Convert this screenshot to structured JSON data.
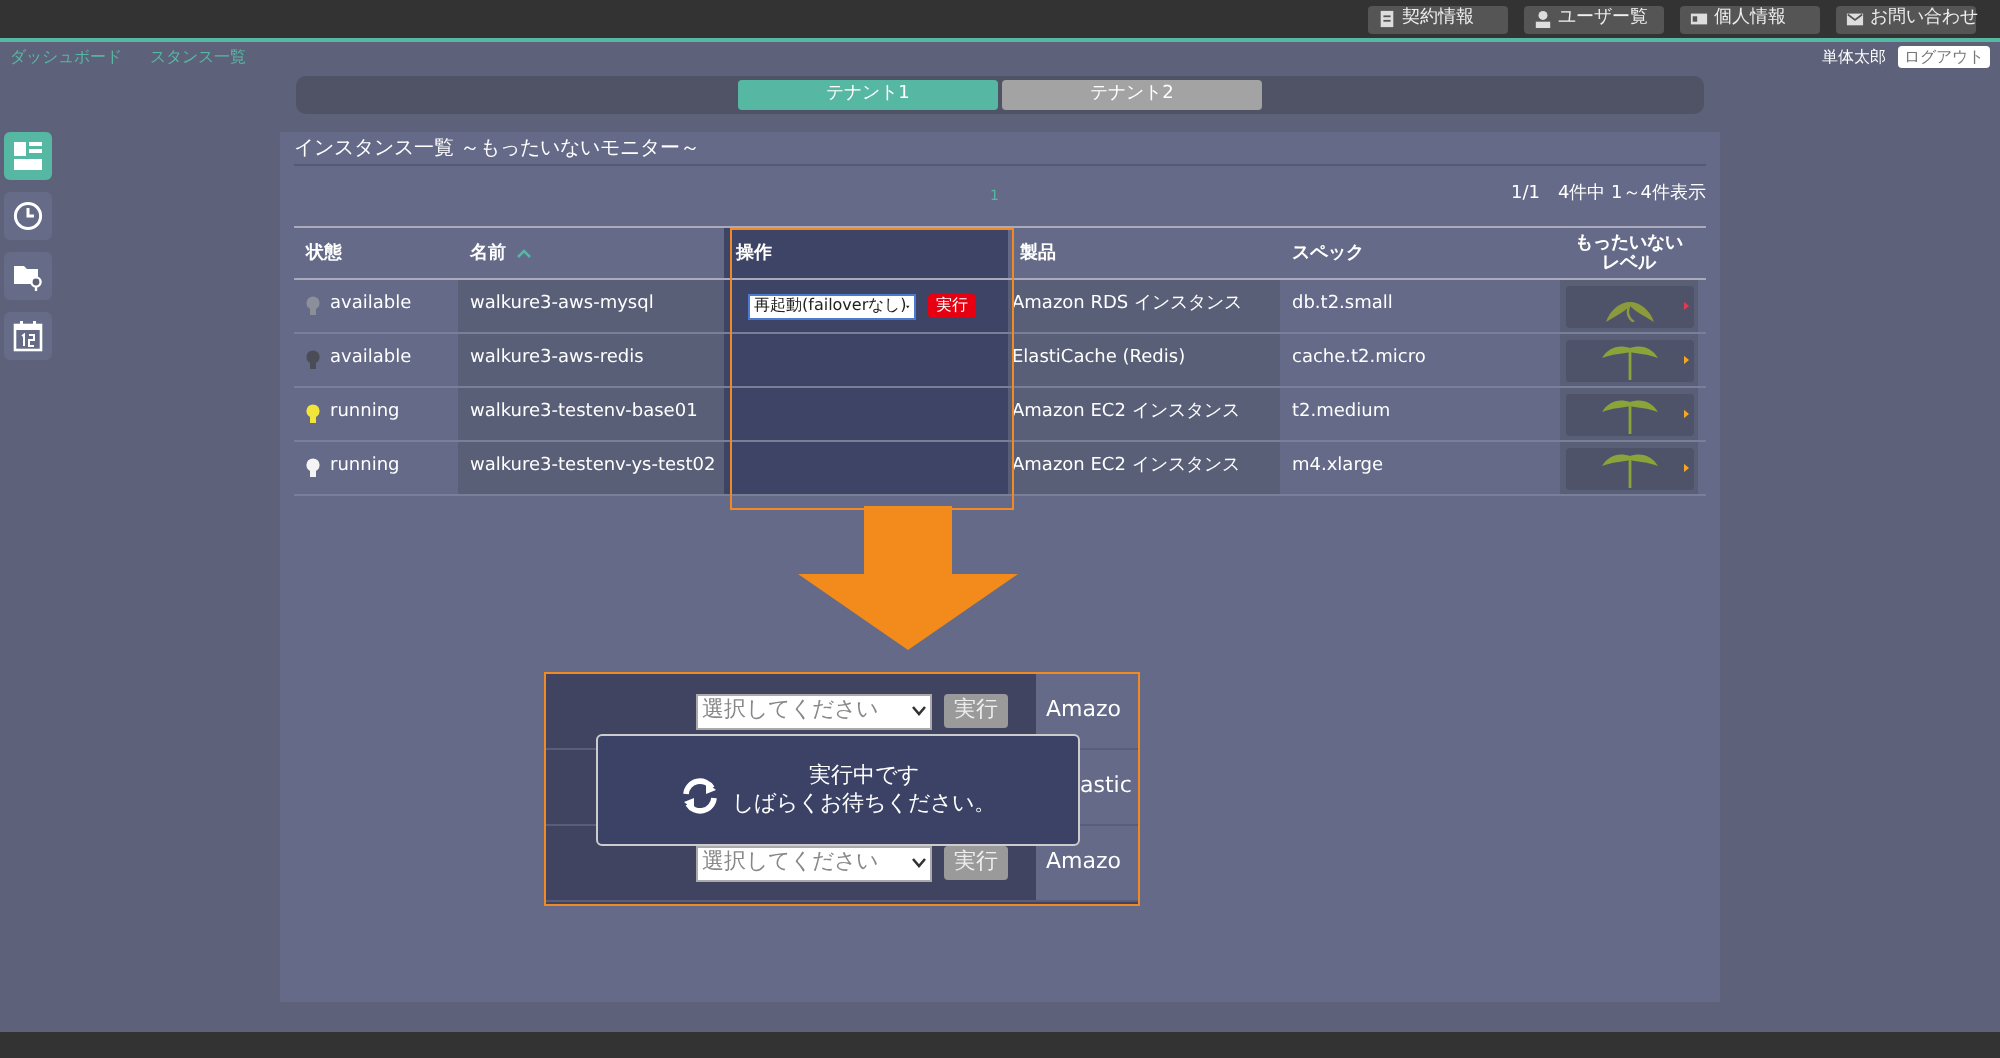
{
  "header": {
    "buttons": [
      {
        "label": "契約情報"
      },
      {
        "label": "ユーザー覧"
      },
      {
        "label": "個人情報"
      },
      {
        "label": "お問い合わせ"
      }
    ]
  },
  "breadcrumbs": [
    "ダッシュボード",
    "スタンス一覧"
  ],
  "user": {
    "name": "単体太郎",
    "logout": "ログアウト"
  },
  "sidebar": {
    "items": [
      {
        "selected": true
      },
      {
        "selected": false
      },
      {
        "selected": false
      },
      {
        "selected": false
      }
    ]
  },
  "tenant_tabs": [
    {
      "label": "テナント1",
      "selected": true
    },
    {
      "label": "テナント2",
      "selected": false
    }
  ],
  "panel": {
    "title": "インスタンス一覧 ～もったいないモニター～",
    "page_link": "1",
    "pager": "1/1　4件中 1～4件表示"
  },
  "table": {
    "columns": [
      "状態",
      "名前",
      "操作",
      "製品",
      "スペック",
      "もったいないレベル"
    ],
    "rows": [
      {
        "status": "available",
        "color": "#8a8f99",
        "name": "walkure3-aws-mysql",
        "operation": {
          "select": "再起動(failoverなし)",
          "button": "実行"
        },
        "product": "Amazon RDS インスタンス",
        "spec": "db.t2.small",
        "level": {
          "kind": "wilted",
          "color": "#e53950"
        }
      },
      {
        "status": "available",
        "color": "#4a4d55",
        "name": "walkure3-aws-redis",
        "product": "ElastiCache (Redis)",
        "spec": "cache.t2.micro",
        "level": {
          "kind": "upright",
          "color": "#f5a623"
        }
      },
      {
        "status": "running",
        "color": "#f2e53a",
        "name": "walkure3-testenv-base01",
        "product": "Amazon EC2 インスタンス",
        "spec": "t2.medium",
        "level": {
          "kind": "upright",
          "color": "#f5a623"
        }
      },
      {
        "status": "running",
        "color": "#f4f4f4",
        "name": "walkure3-testenv-ys-test02",
        "product": "Amazon EC2 インスタンス",
        "spec": "m4.xlarge",
        "level": {
          "kind": "upright",
          "color": "#f5a623"
        }
      }
    ]
  },
  "inset": {
    "rows": [
      {
        "select": "選択してください",
        "button": "実行",
        "product": "Amazo"
      },
      {
        "product": "astic"
      },
      {
        "select": "選択してください",
        "button": "実行",
        "product": "Amazo"
      }
    ],
    "dialog": {
      "lines": [
        "実行中です",
        "しばらくお待ちください。"
      ]
    }
  }
}
